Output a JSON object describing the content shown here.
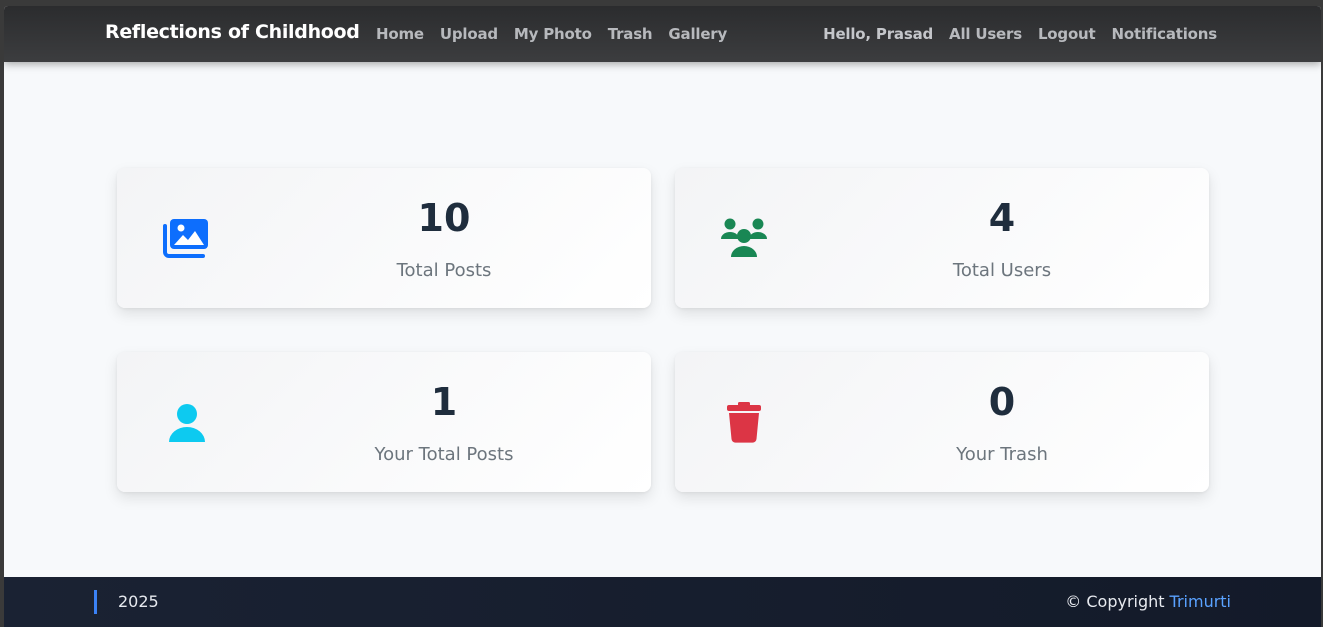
{
  "navbar": {
    "brand": "Reflections of Childhood",
    "links": [
      "Home",
      "Upload",
      "My Photo",
      "Trash",
      "Gallery"
    ],
    "right_links": [
      "Hello, Prasad",
      "All Users",
      "Logout",
      "Notifications"
    ]
  },
  "cards": [
    {
      "value": "10",
      "label": "Total Posts",
      "icon": "images-icon",
      "color": "#0d6efd"
    },
    {
      "value": "4",
      "label": "Total Users",
      "icon": "users-icon",
      "color": "#198754"
    },
    {
      "value": "1",
      "label": "Your Total Posts",
      "icon": "user-icon",
      "color": "#0dcaf0"
    },
    {
      "value": "0",
      "label": "Your Trash",
      "icon": "trash-icon",
      "color": "#dc3545"
    }
  ],
  "footer": {
    "year": "2025",
    "copyright": "© Copyright",
    "author": "Trimurti",
    "accent": "#3b82f6"
  }
}
